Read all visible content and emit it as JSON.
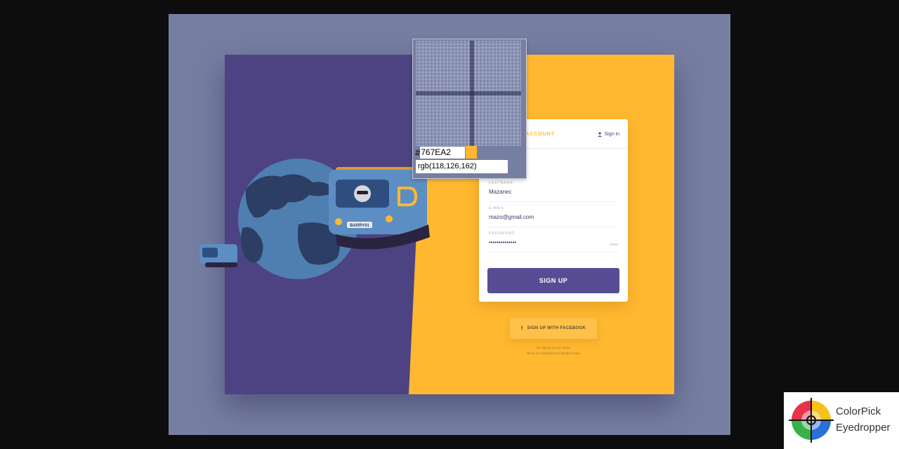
{
  "signup_card": {
    "tab_label": "ACCOUNT",
    "signin_label": "Sign in",
    "fields": [
      {
        "label": "LASTNAME",
        "value": "Mazanec"
      },
      {
        "label": "E-MAIL",
        "value": "mazo@gmail.com"
      },
      {
        "label": "PASSWORD",
        "value": "••••••••••••••",
        "action": "show"
      }
    ],
    "submit_label": "SIGN UP"
  },
  "facebook_button": {
    "label": "SIGN UP WITH FACEBOOK",
    "icon": "facebook-icon"
  },
  "terms": {
    "line1": "By signing up you agree",
    "line2": "Terms & Conditions and Quality Policy"
  },
  "illustration": {
    "plate": "BARRY01"
  },
  "color_picker": {
    "hash": "#",
    "hex": "767EA2",
    "rgb": "rgb(118,126,162)",
    "swatch_color": "#ffb830"
  },
  "app_badge": {
    "line1": "ColorPick",
    "line2": "Eyedropper"
  },
  "colors": {
    "backdrop": "#767ea2",
    "purple": "#4d4382",
    "yellow": "#ffb830",
    "button": "#584c95"
  }
}
